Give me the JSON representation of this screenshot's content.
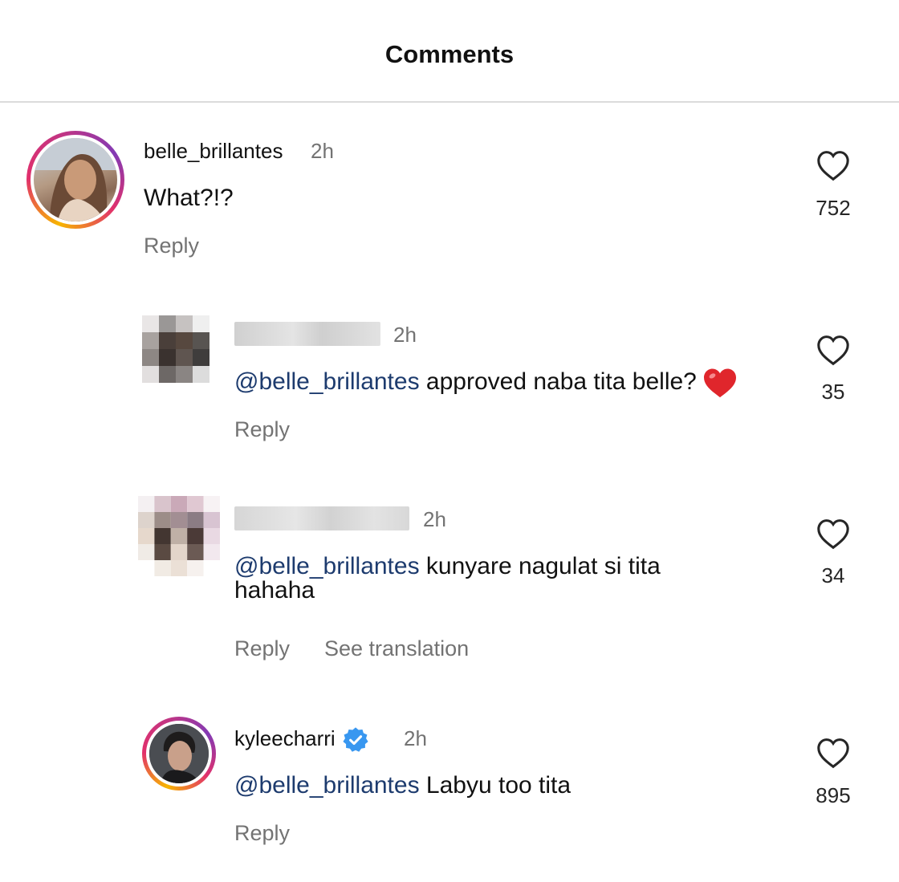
{
  "header": {
    "title": "Comments"
  },
  "comments": [
    {
      "username": "belle_brillantes",
      "time": "2h",
      "text": "What?!?",
      "reply": "Reply",
      "likes": "752"
    },
    {
      "username": "",
      "time": "2h",
      "mention": "@belle_brillantes",
      "text": " approved naba tita belle?",
      "emoji": "heart-emoji",
      "reply": "Reply",
      "likes": "35"
    },
    {
      "username": "",
      "time": "2h",
      "mention": "@belle_brillantes",
      "text": " kunyare nagulat si tita",
      "text2": "hahaha",
      "reply": "Reply",
      "translate": "See translation",
      "likes": "34"
    },
    {
      "username": "kyleecharri",
      "verified": true,
      "time": "2h",
      "mention": "@belle_brillantes",
      "text": " Labyu too tita",
      "reply": "Reply",
      "likes": "895"
    }
  ],
  "colors": {
    "mention": "#1d3b6e",
    "muted": "#737373",
    "ring_start": "#f7b500",
    "ring_end": "#c13584",
    "verified": "#3897f0",
    "emoji_heart": "#e0262c"
  },
  "icons": {
    "like": "heart-outline-icon",
    "verified": "verified-badge-icon",
    "emoji": "red-heart-emoji"
  }
}
